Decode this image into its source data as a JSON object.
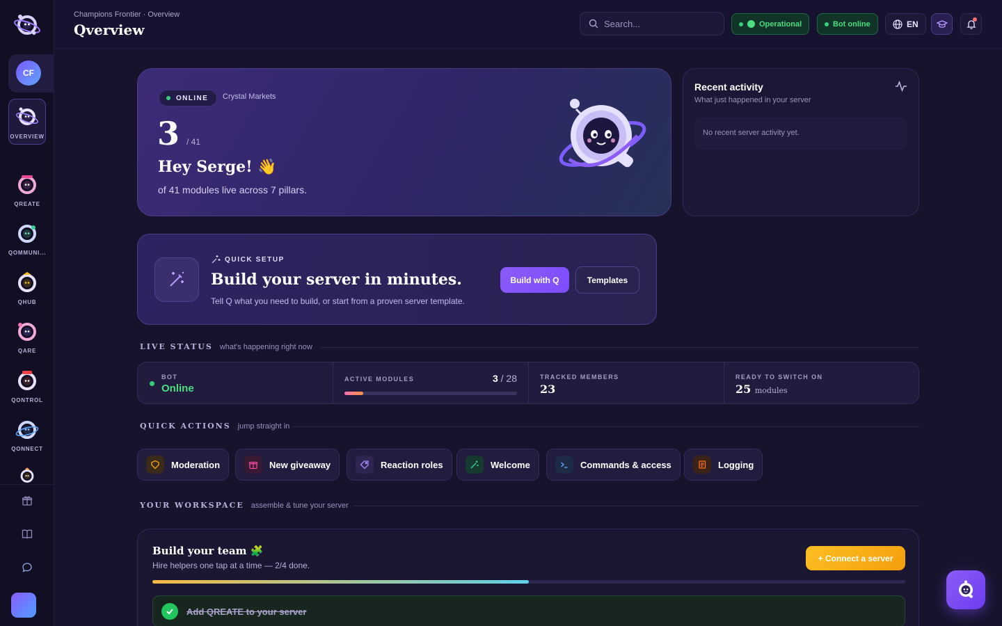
{
  "header": {
    "breadcrumb": "Champions Frontier · Overview",
    "title": "Qverview",
    "search_placeholder": "Search...",
    "status_operational": "Operational",
    "status_bot": "Bot online",
    "language": "EN"
  },
  "sidebar": {
    "server_initials": "CF",
    "items": [
      {
        "label": "OVERVIEW",
        "icon": "q-mascot-icon"
      },
      {
        "label": "QREATE",
        "icon": "q-mascot-icon"
      },
      {
        "label": "QOMMUNI...",
        "icon": "q-mascot-icon"
      },
      {
        "label": "QHUB",
        "icon": "q-mascot-icon"
      },
      {
        "label": "QARE",
        "icon": "q-mascot-icon"
      },
      {
        "label": "QONTROL",
        "icon": "q-mascot-icon"
      },
      {
        "label": "QONNECT",
        "icon": "q-mascot-icon"
      }
    ],
    "bottom_icons": [
      "gift-icon",
      "book-icon",
      "chat-icon"
    ]
  },
  "hero": {
    "status": "ONLINE",
    "server": "Crystal Markets",
    "count": "3",
    "total": "/ 41",
    "greeting": "Hey Serge! 👋",
    "subtitle": "of 41 modules live across 7 pillars."
  },
  "recent": {
    "title": "Recent activity",
    "subtitle": "What just happened in your server",
    "empty": "No recent server activity yet."
  },
  "setup": {
    "eyebrow": "QUICK SETUP",
    "title": "Build your server in minutes.",
    "subtitle": "Tell Q what you need to build, or start from a proven server template.",
    "primary": "Build with Q",
    "secondary": "Templates"
  },
  "live": {
    "title": "LIVE STATUS",
    "subtitle": "what's happening right now",
    "bot_label": "BOT",
    "bot_value": "Online",
    "modules_label": "ACTIVE MODULES",
    "modules_value": "3",
    "modules_total": "/ 28",
    "modules_progress": 0.107,
    "members_label": "TRACKED MEMBERS",
    "members_value": "23",
    "ready_label": "READY TO SWITCH ON",
    "ready_value": "25",
    "ready_unit": "modules"
  },
  "quick_actions": {
    "title": "QUICK ACTIONS",
    "subtitle": "jump straight in",
    "items": [
      {
        "label": "Moderation",
        "icon": "shield-icon",
        "color": "#f59e0b"
      },
      {
        "label": "New giveaway",
        "icon": "gift-icon",
        "color": "#ec4899"
      },
      {
        "label": "Reaction roles",
        "icon": "tag-icon",
        "color": "#a78bfa"
      },
      {
        "label": "Welcome",
        "icon": "wand-icon",
        "color": "#34d399"
      },
      {
        "label": "Commands & access",
        "icon": "terminal-icon",
        "color": "#60a5fa"
      },
      {
        "label": "Logging",
        "icon": "scroll-icon",
        "color": "#f97316"
      }
    ]
  },
  "workspace": {
    "title": "YOUR WORKSPACE",
    "subtitle": "assemble & tune your server",
    "card_title": "Build your team 🧩",
    "card_sub": "Hire helpers one tap at a time — 2/4 done.",
    "connect": "+ Connect a server",
    "progress": 0.5,
    "task": "Add QREATE to your server"
  }
}
